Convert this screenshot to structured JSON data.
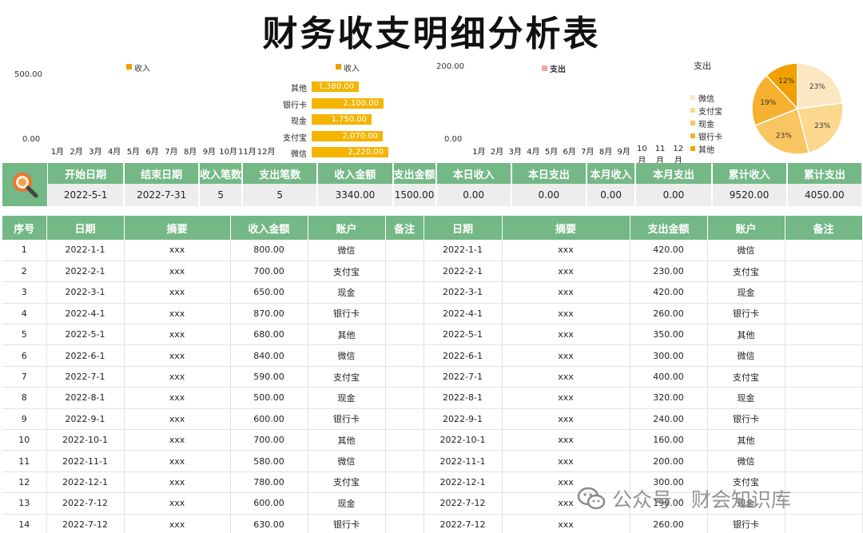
{
  "page": {
    "title": "财务收支明细分析表"
  },
  "charts": {
    "income_line": {
      "legend": "收入",
      "y_top": "500.00",
      "y_bottom": "0.00",
      "months": [
        "1月",
        "2月",
        "3月",
        "4月",
        "5月",
        "6月",
        "7月",
        "8月",
        "9月",
        "10月",
        "11月",
        "12月"
      ]
    },
    "income_bar": {
      "legend": "收入",
      "categories": [
        "其他",
        "银行卡",
        "现金",
        "支付宝",
        "微信"
      ],
      "labels": [
        "1,380.00",
        "2,100.00",
        "1,750.00",
        "2,070.00",
        "2,220.00"
      ],
      "values": [
        1380,
        2100,
        1750,
        2070,
        2220
      ],
      "max": 2600,
      "color": "#f4b400"
    },
    "expense_line": {
      "legend": "支出",
      "y_top": "200.00",
      "y_bottom": "0.00",
      "months": [
        "1月",
        "2月",
        "3月",
        "4月",
        "5月",
        "6月",
        "7月",
        "8月",
        "9月",
        "10月",
        "11月",
        "12月"
      ]
    },
    "expense_pie": {
      "title": "支出",
      "legend": [
        "微信",
        "支付宝",
        "现金",
        "银行卡",
        "其他"
      ],
      "slices": [
        {
          "pct": 23,
          "label": "23%",
          "color": "#fbe8c3"
        },
        {
          "pct": 23,
          "label": "23%",
          "color": "#fbd88d"
        },
        {
          "pct": 23,
          "label": "23%",
          "color": "#f9c560"
        },
        {
          "pct": 19,
          "label": "19%",
          "color": "#f5b12f"
        },
        {
          "pct": 12,
          "label": "12%",
          "color": "#f0a000"
        }
      ]
    }
  },
  "summary": {
    "headers": [
      "开始日期",
      "结束日期",
      "收入笔数",
      "支出笔数",
      "收入金额",
      "支出金额",
      "本日收入",
      "本日支出",
      "本月收入",
      "本月支出",
      "累计收入",
      "累计支出"
    ],
    "values": [
      "2022-5-1",
      "2022-7-31",
      "5",
      "5",
      "3340.00",
      "1500.00",
      "0.00",
      "0.00",
      "0.00",
      "0.00",
      "9520.00",
      "4050.00"
    ]
  },
  "table": {
    "headers": [
      "序号",
      "日期",
      "摘要",
      "收入金额",
      "账户",
      "备注",
      "日期",
      "摘要",
      "支出金额",
      "账户",
      "备注"
    ],
    "rows": [
      [
        "1",
        "2022-1-1",
        "xxx",
        "800.00",
        "微信",
        "",
        "2022-1-1",
        "xxx",
        "420.00",
        "微信",
        ""
      ],
      [
        "2",
        "2022-2-1",
        "xxx",
        "700.00",
        "支付宝",
        "",
        "2022-2-1",
        "xxx",
        "230.00",
        "支付宝",
        ""
      ],
      [
        "3",
        "2022-3-1",
        "xxx",
        "650.00",
        "现金",
        "",
        "2022-3-1",
        "xxx",
        "420.00",
        "现金",
        ""
      ],
      [
        "4",
        "2022-4-1",
        "xxx",
        "870.00",
        "银行卡",
        "",
        "2022-4-1",
        "xxx",
        "260.00",
        "银行卡",
        ""
      ],
      [
        "5",
        "2022-5-1",
        "xxx",
        "680.00",
        "其他",
        "",
        "2022-5-1",
        "xxx",
        "350.00",
        "其他",
        ""
      ],
      [
        "6",
        "2022-6-1",
        "xxx",
        "840.00",
        "微信",
        "",
        "2022-6-1",
        "xxx",
        "300.00",
        "微信",
        ""
      ],
      [
        "7",
        "2022-7-1",
        "xxx",
        "590.00",
        "支付宝",
        "",
        "2022-7-1",
        "xxx",
        "400.00",
        "支付宝",
        ""
      ],
      [
        "8",
        "2022-8-1",
        "xxx",
        "500.00",
        "现金",
        "",
        "2022-8-1",
        "xxx",
        "320.00",
        "现金",
        ""
      ],
      [
        "9",
        "2022-9-1",
        "xxx",
        "600.00",
        "银行卡",
        "",
        "2022-9-1",
        "xxx",
        "240.00",
        "银行卡",
        ""
      ],
      [
        "10",
        "2022-10-1",
        "xxx",
        "700.00",
        "其他",
        "",
        "2022-10-1",
        "xxx",
        "160.00",
        "其他",
        ""
      ],
      [
        "11",
        "2022-11-1",
        "xxx",
        "580.00",
        "微信",
        "",
        "2022-11-1",
        "xxx",
        "200.00",
        "微信",
        ""
      ],
      [
        "12",
        "2022-12-1",
        "xxx",
        "780.00",
        "支付宝",
        "",
        "2022-12-1",
        "xxx",
        "300.00",
        "支付宝",
        ""
      ],
      [
        "13",
        "2022-7-12",
        "xxx",
        "600.00",
        "现金",
        "",
        "2022-7-12",
        "xxx",
        "190.00",
        "现金",
        ""
      ],
      [
        "14",
        "2022-7-12",
        "xxx",
        "630.00",
        "银行卡",
        "",
        "2022-7-12",
        "xxx",
        "260.00",
        "银行卡",
        ""
      ]
    ]
  },
  "watermark": {
    "text": "公众号 · 财会知识库"
  },
  "colors": {
    "header_green": "#73b885",
    "bar_gold": "#f4b400",
    "magnifier_orange": "#e8762b"
  }
}
